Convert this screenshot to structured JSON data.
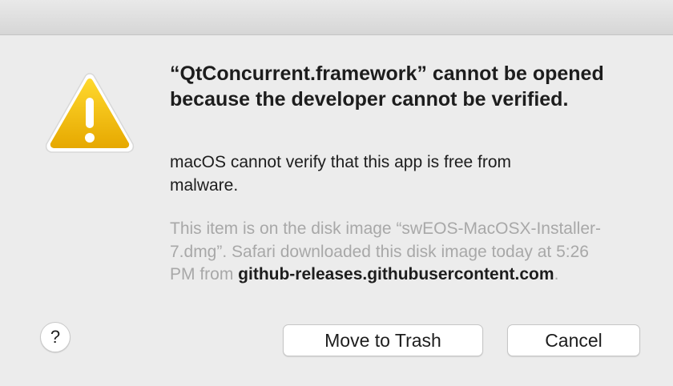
{
  "dialog": {
    "title": "“QtConcurrent.framework” cannot be opened because the developer cannot be verified.",
    "message": "macOS cannot verify that this app is free from malware.",
    "info": {
      "prefix": "This item is on the disk image “swEOS-MacOSX-Installer-7.dmg”. Safari downloaded this disk image today at 5:26 PM from ",
      "host": "github-releases.githubusercontent.com",
      "suffix": "."
    },
    "icon": "warning-icon",
    "accent_color": "#f5c400"
  },
  "buttons": {
    "help_label": "?",
    "trash_label": "Move to Trash",
    "cancel_label": "Cancel"
  }
}
